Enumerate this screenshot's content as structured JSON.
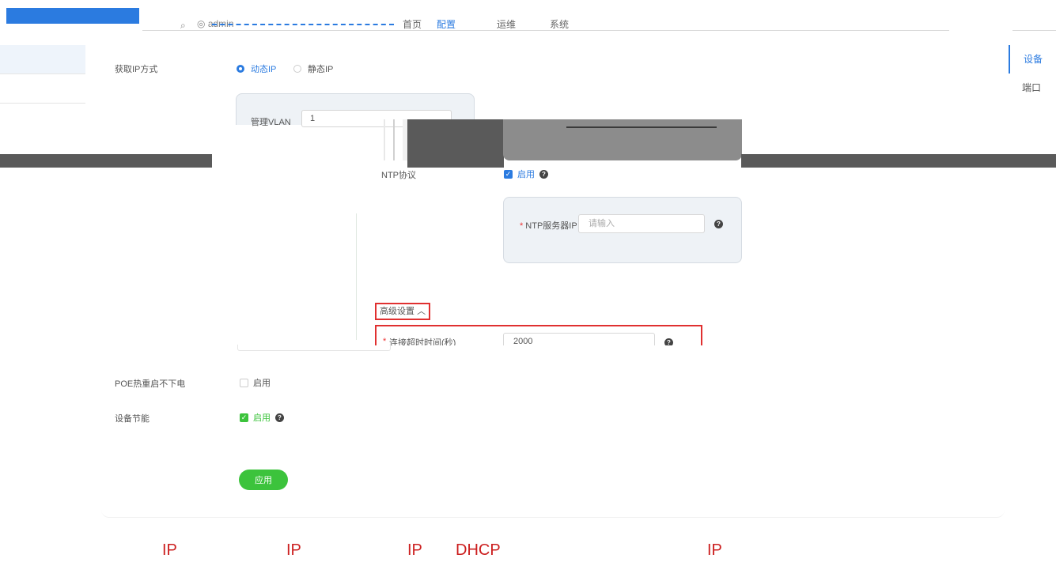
{
  "topbar": {
    "user": "admin",
    "nav": [
      "首页",
      "配置",
      "运维",
      "系统"
    ]
  },
  "right_tabs": [
    "设备",
    "端口"
  ],
  "upper_form": {
    "ip_mode_label": "获取IP方式",
    "radio_dynamic": "动态IP",
    "radio_static": "静态IP",
    "ip_mode_selected": "动态IP",
    "vlan_label": "管理VLAN",
    "vlan_value": "1"
  },
  "ntp": {
    "label": "NTP协议",
    "enable_label": "启用",
    "enabled": true,
    "server_label": "NTP服务器IP",
    "server_placeholder": "请输入",
    "server_required": true
  },
  "advanced": {
    "toggle_label": "高级设置",
    "chevron": "chevron-up-icon",
    "timeout_label": "连接超时时间(秒)",
    "timeout_value": "2000"
  },
  "lower_form": {
    "poe_label": "POE热重启不下电",
    "poe_enable_label": "启用",
    "poe_enabled": false,
    "energy_label": "设备节能",
    "energy_enable_label": "启用",
    "energy_enabled": true,
    "apply_label": "应用"
  },
  "caption": [
    "IP",
    "IP",
    "IP",
    "DHCP",
    "IP"
  ],
  "colors": {
    "accent_blue": "#2b7be0",
    "accent_green": "#3cc33c",
    "highlight_red": "#e03030",
    "caption_red": "#cc1f1f"
  }
}
